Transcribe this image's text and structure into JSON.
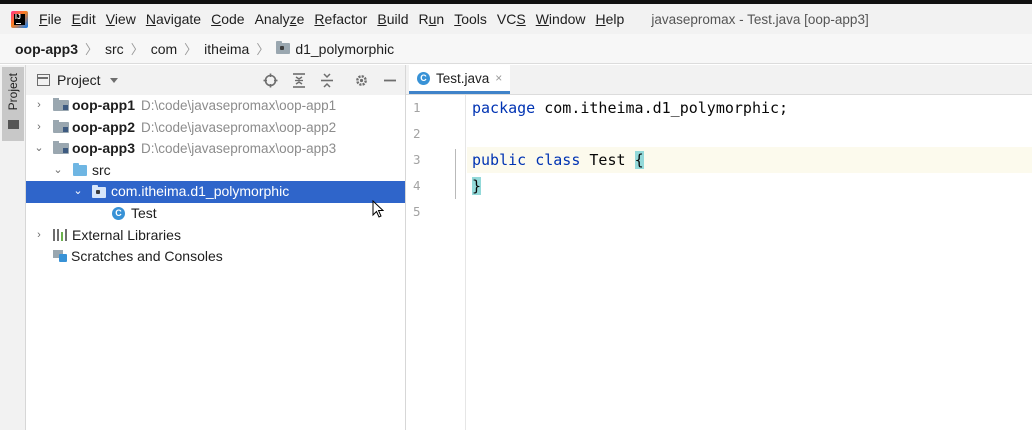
{
  "menubar": {
    "items": [
      {
        "name": "file",
        "pre": "",
        "mn": "F",
        "post": "ile"
      },
      {
        "name": "edit",
        "pre": "",
        "mn": "E",
        "post": "dit"
      },
      {
        "name": "view",
        "pre": "",
        "mn": "V",
        "post": "iew"
      },
      {
        "name": "navigate",
        "pre": "",
        "mn": "N",
        "post": "avigate"
      },
      {
        "name": "code",
        "pre": "",
        "mn": "C",
        "post": "ode"
      },
      {
        "name": "analyze",
        "pre": "Analy",
        "mn": "z",
        "post": "e"
      },
      {
        "name": "refactor",
        "pre": "",
        "mn": "R",
        "post": "efactor"
      },
      {
        "name": "build",
        "pre": "",
        "mn": "B",
        "post": "uild"
      },
      {
        "name": "run",
        "pre": "R",
        "mn": "u",
        "post": "n"
      },
      {
        "name": "tools",
        "pre": "",
        "mn": "T",
        "post": "ools"
      },
      {
        "name": "vcs",
        "pre": "VC",
        "mn": "S",
        "post": ""
      },
      {
        "name": "window",
        "pre": "",
        "mn": "W",
        "post": "indow"
      },
      {
        "name": "help",
        "pre": "",
        "mn": "H",
        "post": "elp"
      }
    ],
    "window_title": "javasepromax - Test.java [oop-app3]"
  },
  "breadcrumb": {
    "items": [
      "oop-app3",
      "src",
      "com",
      "itheima",
      "d1_polymorphic"
    ]
  },
  "sidebar": {
    "tab_label": "Project"
  },
  "project_panel": {
    "title": "Project",
    "tree": [
      {
        "label": "oop-app1",
        "path": "D:\\code\\javasepromax\\oop-app1",
        "arrow": "›"
      },
      {
        "label": "oop-app2",
        "path": "D:\\code\\javasepromax\\oop-app2",
        "arrow": "›"
      },
      {
        "label": "oop-app3",
        "path": "D:\\code\\javasepromax\\oop-app3",
        "arrow": "⌄"
      },
      {
        "label": "src",
        "arrow": "⌄"
      },
      {
        "label": "com.itheima.d1_polymorphic",
        "arrow": "⌄"
      },
      {
        "label": "Test",
        "icon_letter": "C"
      },
      {
        "label": "External Libraries",
        "arrow": "›"
      },
      {
        "label": "Scratches and Consoles"
      }
    ]
  },
  "editor": {
    "tab": {
      "label": "Test.java",
      "icon_letter": "C",
      "close": "×"
    },
    "line_numbers": [
      "1",
      "2",
      "3",
      "4",
      "5"
    ],
    "lines": {
      "l1_kw": "package",
      "l1_rest": " com.itheima.d1_polymorphic;",
      "l3_kw1": "public",
      "l3_kw2": "class",
      "l3_name": " Test ",
      "l3_brace": "{",
      "l4_brace": "}"
    }
  },
  "colors": {
    "selection": "#2f65ca",
    "keyword": "#0033b3",
    "brace_highlight": "#93d9d9",
    "current_line": "#fcfaed"
  }
}
